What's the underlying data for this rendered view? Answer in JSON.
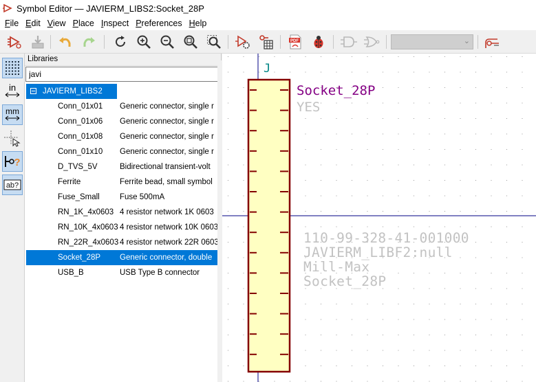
{
  "window": {
    "title": "Symbol Editor — JAVIERM_LIBS2:Socket_28P"
  },
  "menu": [
    {
      "label": "File",
      "key": "F",
      "rest": "ile"
    },
    {
      "label": "Edit",
      "key": "E",
      "rest": "dit"
    },
    {
      "label": "View",
      "key": "V",
      "rest": "iew"
    },
    {
      "label": "Place",
      "key": "P",
      "rest": "lace"
    },
    {
      "label": "Inspect",
      "key": "I",
      "rest": "nspect"
    },
    {
      "label": "Preferences",
      "key": "P",
      "rest": "references"
    },
    {
      "label": "Help",
      "key": "H",
      "rest": "elp"
    }
  ],
  "toolbar": {
    "icons": [
      "new-symbol-icon",
      "save-icon",
      "undo-icon",
      "redo-icon",
      "refresh-icon",
      "zoom-in-icon",
      "zoom-out-icon",
      "zoom-fit-icon",
      "zoom-selection-icon",
      "symbol-properties-icon",
      "pin-table-icon",
      "datasheet-pdf-icon",
      "run-erc-icon",
      "de-morgan-standard-icon",
      "de-morgan-alternate-icon",
      "unit-select",
      "symbol-checker-icon"
    ],
    "unit_select_value": ""
  },
  "left_toolbar": {
    "icons": [
      "grid-toggle-icon",
      "units-inches-icon",
      "units-mm-icon",
      "cursor-crosshair-icon",
      "pin-type-icon",
      "pin-names-icon"
    ],
    "inch_label": "in",
    "mm_label": "mm",
    "pin_label": "?",
    "text_label": "ab?"
  },
  "libraries": {
    "header": "Libraries",
    "search_value": "javi",
    "library_name": "JAVIERM_LIBS2",
    "items": [
      {
        "name": "Conn_01x01",
        "desc": "Generic connector, single r"
      },
      {
        "name": "Conn_01x06",
        "desc": "Generic connector, single r"
      },
      {
        "name": "Conn_01x08",
        "desc": "Generic connector, single r"
      },
      {
        "name": "Conn_01x10",
        "desc": "Generic connector, single r"
      },
      {
        "name": "D_TVS_5V",
        "desc": "Bidirectional transient-volt"
      },
      {
        "name": "Ferrite",
        "desc": "Ferrite bead, small symbol"
      },
      {
        "name": "Fuse_Small",
        "desc": "Fuse 500mA"
      },
      {
        "name": "RN_1K_4x0603",
        "desc": "4 resistor network 1K 0603"
      },
      {
        "name": "RN_10K_4x0603",
        "desc": "4 resistor network 10K 0603"
      },
      {
        "name": "RN_22R_4x0603",
        "desc": "4 resistor network 22R 0603"
      },
      {
        "name": "Socket_28P",
        "desc": "Generic connector, double"
      },
      {
        "name": "USB_B",
        "desc": "USB Type B connector"
      }
    ],
    "selected_index": 10
  },
  "canvas": {
    "reference": "J",
    "value": "Socket_28P",
    "extra_field": "YES",
    "fields": [
      "110-99-328-41-001000",
      "JAVIERM_LIBF2:null",
      "Mill-Max",
      "Socket_28P"
    ],
    "colors": {
      "body_fill": "#ffffc2",
      "body_stroke": "#840000",
      "reference": "#008484",
      "value": "#840084",
      "hidden": "#c2c2c2",
      "axis": "#000084",
      "grid": "#9a9a9a",
      "selection": "#0078d7"
    }
  }
}
